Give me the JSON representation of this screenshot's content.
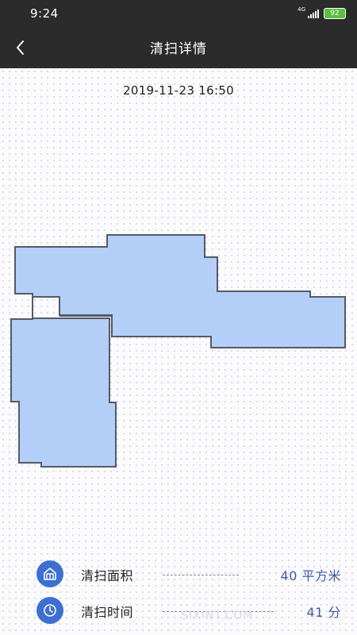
{
  "status_bar": {
    "time": "9:24",
    "network": "4G",
    "battery": "92"
  },
  "header": {
    "title": "清扫详情"
  },
  "record": {
    "datetime": "2019-11-23 16:50"
  },
  "stats": [
    {
      "icon": "house-icon",
      "label": "清扫面积",
      "value": "40 平方米"
    },
    {
      "icon": "clock-icon",
      "label": "清扫时间",
      "value": "41 分"
    }
  ],
  "watermark": "SIXINT.COM",
  "colors": {
    "bar": "#2b2b2b",
    "map_fill": "#b3cff7",
    "map_stroke": "#555a66",
    "accent": "#3d6fd3",
    "value_text": "#3d5ba8",
    "battery": "#5cbf3f"
  }
}
